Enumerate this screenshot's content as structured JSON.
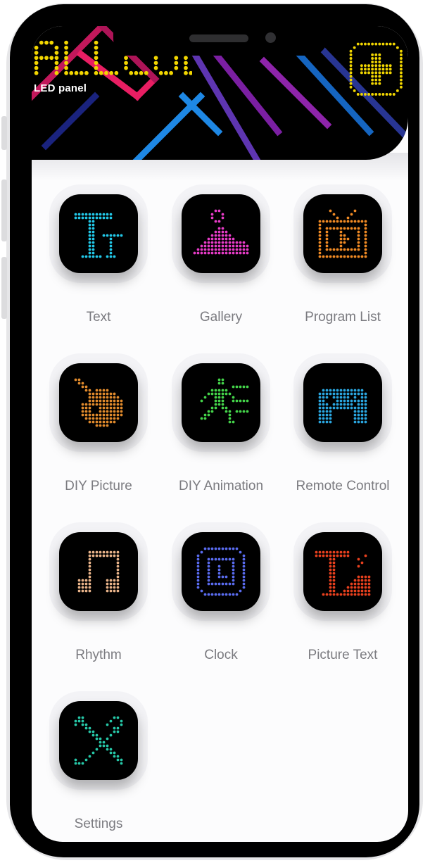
{
  "header": {
    "brand_title": "ALLCOLOR",
    "brand_subtitle": "LED panel",
    "accent": "#f2d600"
  },
  "menu": [
    {
      "label": "Text",
      "icon": "text-icon",
      "color": "#22c8e8"
    },
    {
      "label": "Gallery",
      "icon": "gallery-icon",
      "color": "#e83cc8"
    },
    {
      "label": "Program List",
      "icon": "tv-program-icon",
      "color": "#f08a24"
    },
    {
      "label": "DIY Picture",
      "icon": "palette-icon",
      "color": "#e08a2c"
    },
    {
      "label": "DIY Animation",
      "icon": "running-figure-icon",
      "color": "#44d44a"
    },
    {
      "label": "Remote Control",
      "icon": "gamepad-icon",
      "color": "#2aa6e0"
    },
    {
      "label": "Rhythm",
      "icon": "music-note-icon",
      "color": "#eab48a"
    },
    {
      "label": "Clock",
      "icon": "clock-icon",
      "color": "#5a6cf0"
    },
    {
      "label": "Picture Text",
      "icon": "picture-text-icon",
      "color": "#e8401e"
    },
    {
      "label": "Settings",
      "icon": "tools-icon",
      "color": "#26c8a8"
    }
  ]
}
